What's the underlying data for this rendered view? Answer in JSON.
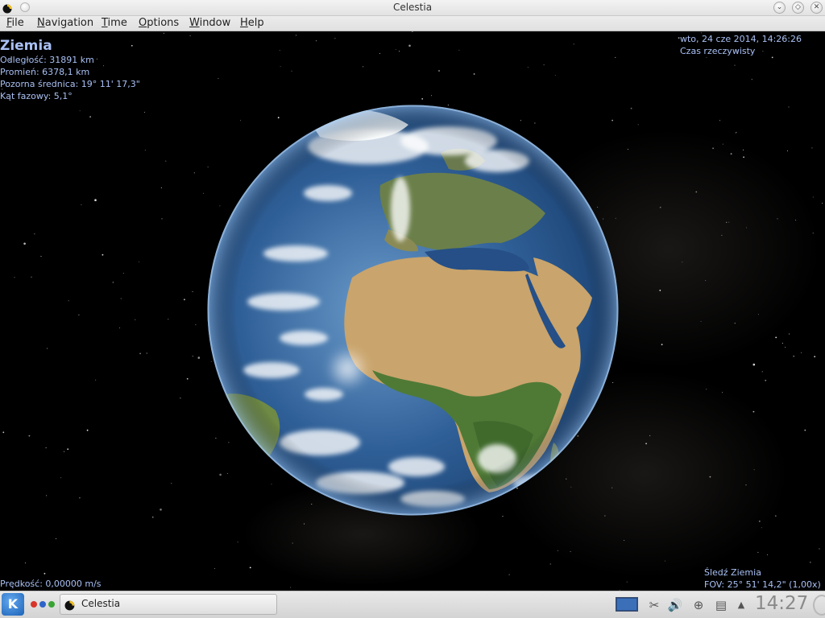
{
  "window": {
    "title": "Celestia"
  },
  "menu": {
    "items": [
      {
        "label": "File",
        "mnemonic": "F",
        "rest": "ile"
      },
      {
        "label": "Navigation",
        "mnemonic": "N",
        "rest": "avigation"
      },
      {
        "label": "Time",
        "mnemonic": "T",
        "rest": "ime"
      },
      {
        "label": "Options",
        "mnemonic": "O",
        "rest": "ptions"
      },
      {
        "label": "Window",
        "mnemonic": "W",
        "rest": "indow"
      },
      {
        "label": "Help",
        "mnemonic": "H",
        "rest": "elp"
      }
    ]
  },
  "object_info": {
    "name": "Ziemia",
    "distance": "Odległość: 31891 km",
    "radius": "Promień: 6378,1 km",
    "apparent_diameter": "Pozorna średnica: 19° 11' 17,3\"",
    "phase_angle": "Kąt fazowy: 5,1°"
  },
  "time_info": {
    "datetime": "wto, 24 cze 2014, 14:26:26",
    "mode": "Czas rzeczywisty"
  },
  "speed": "Prędkość: 0,00000 m/s",
  "tracking": {
    "target": "Śledź Ziemia",
    "fov": "FOV: 25° 51' 14,2\" (1,00x)"
  },
  "taskbar": {
    "start_glyph": "K",
    "task_label": "Celestia",
    "clock": "14:27",
    "pager_colors": [
      "#d9342b",
      "#2e64c8",
      "#3aa335"
    ]
  },
  "colors": {
    "hud_text": "#a9c0f4"
  },
  "icons": {
    "title_app": "celestia-icon",
    "pin": "pin-icon",
    "minimize": "minimize-icon",
    "maximize": "maximize-icon",
    "close": "close-icon",
    "tray": [
      "display-icon",
      "klipper-icon",
      "volume-icon",
      "network-icon",
      "network-manager-icon",
      "tray-expand-icon"
    ]
  }
}
